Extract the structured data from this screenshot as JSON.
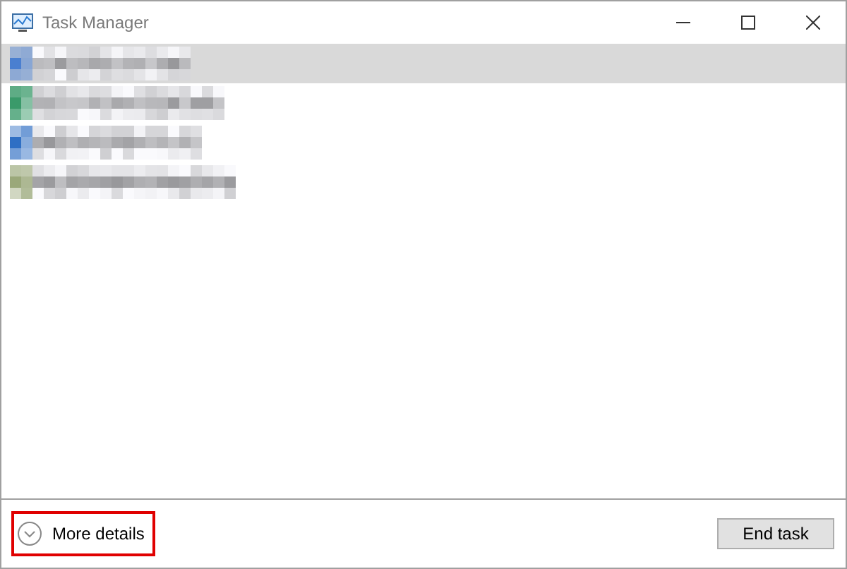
{
  "window": {
    "title": "Task Manager",
    "controls": [
      {
        "kind": "minimize"
      },
      {
        "kind": "maximize"
      },
      {
        "kind": "close"
      }
    ]
  },
  "apps": [
    {
      "selected": true
    },
    {
      "selected": false
    },
    {
      "selected": false
    },
    {
      "selected": false
    }
  ],
  "footer": {
    "more_details": {
      "label": "More details",
      "highlighted": true
    },
    "end_task": {
      "label": "End task",
      "disabled": false
    }
  }
}
